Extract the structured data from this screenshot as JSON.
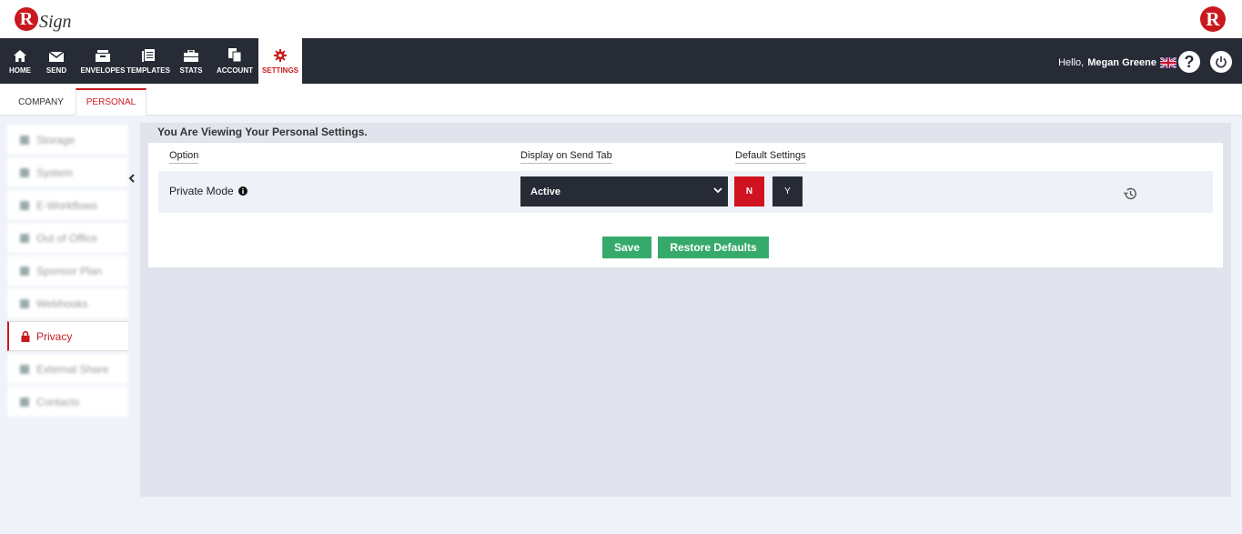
{
  "app": {
    "logo_letter": "R",
    "logo_text": "Sign",
    "right_logo_letter": "R"
  },
  "nav": {
    "items": [
      {
        "label": "HOME",
        "icon": "home-icon"
      },
      {
        "label": "SEND",
        "icon": "envelope-icon"
      },
      {
        "label": "ENVELOPES",
        "icon": "inbox-icon"
      },
      {
        "label": "TEMPLATES",
        "icon": "templates-icon"
      },
      {
        "label": "STATS",
        "icon": "briefcase-icon"
      },
      {
        "label": "ACCOUNT",
        "icon": "account-icon"
      },
      {
        "label": "SETTINGS",
        "icon": "gear-icon",
        "active": true
      }
    ]
  },
  "user": {
    "greeting": "Hello,",
    "name": "Megan Greene",
    "help_glyph": "?"
  },
  "subtabs": [
    {
      "label": "COMPANY"
    },
    {
      "label": "PERSONAL",
      "active": true
    }
  ],
  "sidebar": {
    "items": [
      {
        "label": "Storage"
      },
      {
        "label": "System"
      },
      {
        "label": "E-Workflows"
      },
      {
        "label": "Out of Office"
      },
      {
        "label": "Sponsor Plan"
      },
      {
        "label": "Webhooks"
      },
      {
        "label": "Privacy",
        "icon": "lock-icon",
        "active": true
      },
      {
        "label": "External Share"
      },
      {
        "label": "Contacts"
      }
    ]
  },
  "main": {
    "title": "You Are Viewing Your Personal Settings.",
    "columns": {
      "option": "Option",
      "display": "Display on Send Tab",
      "default": "Default Settings"
    },
    "row": {
      "label": "Private Mode",
      "select_value": "Active",
      "n_label": "N",
      "y_label": "Y"
    },
    "save_label": "Save",
    "restore_label": "Restore Defaults"
  },
  "colors": {
    "brand_red": "#c81a1e",
    "navbar": "#262b36",
    "save_green": "#35aa6b"
  }
}
